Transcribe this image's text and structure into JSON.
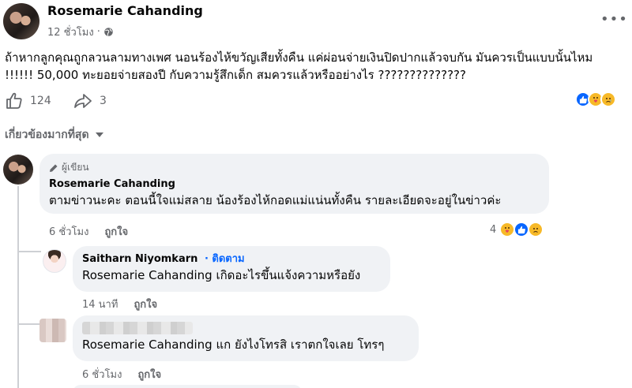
{
  "post": {
    "author": "Rosemarie Cahanding",
    "time": "12 ชั่วโมง",
    "privacy_dot": "·",
    "text": "ถ้าหากลูกคุณถูกลวนลามทางเพศ นอนร้องไห้ขวัญเสียทั้งคืน แค่ผ่อนจ่ายเงินปิดปากแล้วจบกัน มันควรเป็นแบบนั้นไหม !!!!!! 50,000 ทะยอยจ่ายสองปี กับความรู้สึกเด็ก สมควรแล้วหรืออย่างไร ??????????????",
    "like_count": "124",
    "share_count": "3",
    "icons": {
      "more": "more-icon",
      "globe": "globe-icon",
      "like": "like-icon",
      "share": "share-icon"
    },
    "reactions": [
      "like",
      "care",
      "sad"
    ]
  },
  "filter": {
    "label": "เกี่ยวข้องมากที่สุด"
  },
  "comments": [
    {
      "badge": "ผู้เขียน",
      "author": "Rosemarie Cahanding",
      "text": "ตามข่าวนะคะ ตอนนี้ใจแม่สลาย น้องร้องไห้กอดแม่แน่นทั้งคืน รายละเอียดจะอยู่ในข่าวค่ะ",
      "time": "6 ชั่วโมง",
      "like_label": "ถูกใจ",
      "reaction_count": "4",
      "reactions": [
        "care",
        "like",
        "sad"
      ]
    },
    {
      "author": "Saitharn Niyomkarn",
      "follow": "· ติดตาม",
      "mention": "Rosemarie Cahanding",
      "text": " เกิดอะไรขึ้นแจ้งความหรือยัง",
      "time": "14 นาที",
      "like_label": "ถูกใจ"
    },
    {
      "mention": "Rosemarie Cahanding",
      "text": " แก ยังไงโทรสิ เราตกใจเลย โทรๆ",
      "time": "6 ชั่วโมง",
      "like_label": "ถูกใจ"
    }
  ],
  "colors": {
    "link": "#0866ff",
    "bubble": "#f0f2f5",
    "meta": "#65676b",
    "like_blue": "#0866ff",
    "reaction_yellow": "#f7b928"
  }
}
